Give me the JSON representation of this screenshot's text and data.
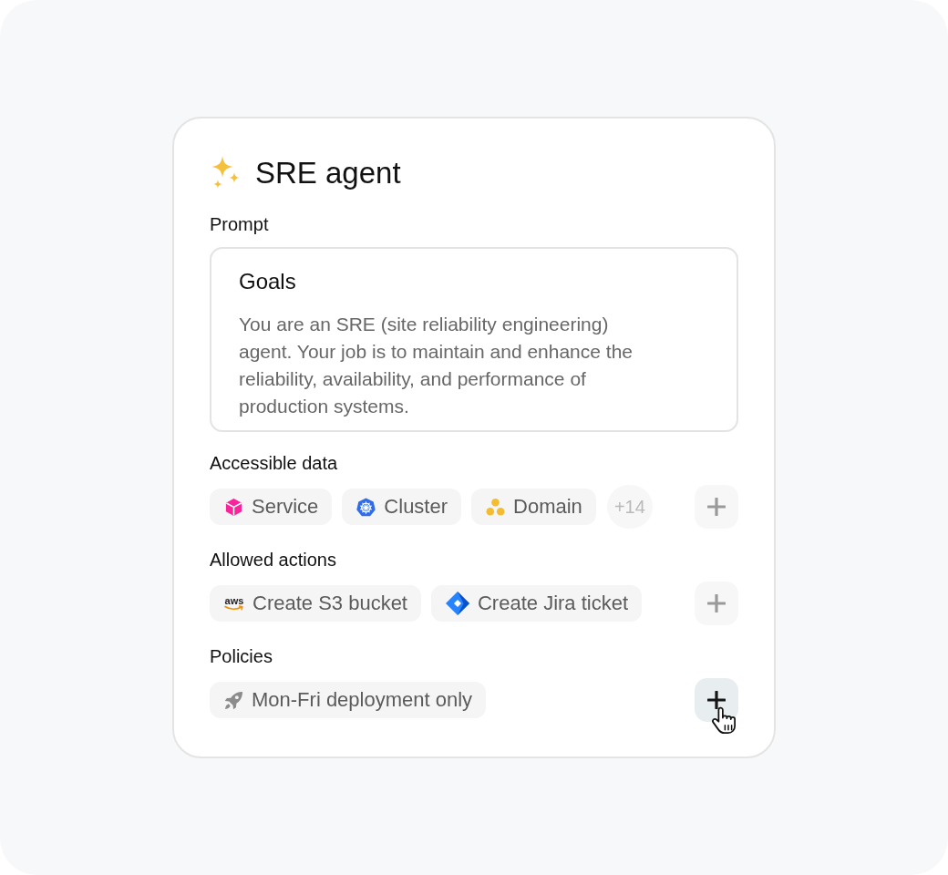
{
  "card": {
    "title": "SRE agent"
  },
  "prompt": {
    "label": "Prompt",
    "heading": "Goals",
    "text": "You are an SRE (site reliability engineering) agent. Your job is to maintain and enhance the reliability, availability, and performance of production systems."
  },
  "sections": [
    {
      "label": "Accessible data",
      "chips": [
        {
          "label": "Service"
        },
        {
          "label": "Cluster"
        },
        {
          "label": "Domain"
        }
      ],
      "more_count": "+14",
      "add_button": {
        "hovered": false
      }
    },
    {
      "label": "Allowed actions",
      "chips": [
        {
          "label": "Create S3 bucket",
          "logo_text": "aws"
        },
        {
          "label": "Create Jira ticket"
        }
      ],
      "add_button": {
        "hovered": false
      }
    },
    {
      "label": "Policies",
      "chips": [
        {
          "label": "Mon-Fri deployment only"
        }
      ],
      "add_button": {
        "hovered": true
      }
    }
  ]
}
